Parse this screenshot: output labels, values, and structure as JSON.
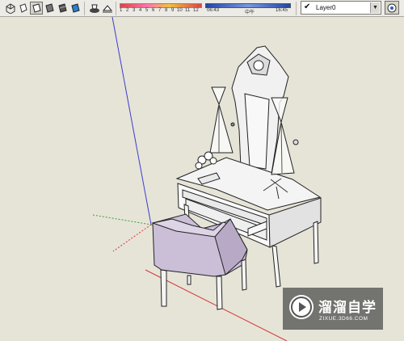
{
  "toolbar": {
    "view_buttons": [
      {
        "name": "xray-style-icon"
      },
      {
        "name": "wireframe-style-icon"
      },
      {
        "name": "hidden-line-style-icon",
        "active": true
      },
      {
        "name": "shaded-style-icon"
      },
      {
        "name": "shaded-textures-style-icon"
      },
      {
        "name": "monochrome-style-icon"
      }
    ],
    "months": [
      "1",
      "2",
      "3",
      "4",
      "5",
      "6",
      "7",
      "8",
      "9",
      "10",
      "11",
      "12"
    ],
    "time_start": "06:43",
    "time_mid": "中午",
    "time_end": "16:45"
  },
  "layer": {
    "checkmark": "✔",
    "current": "Layer0"
  },
  "watermark": {
    "brand": "溜溜自学",
    "url": "ZIXUE.3D66.COM"
  },
  "colors": {
    "viewport_bg": "#e6e4d7",
    "blue_axis": "#3c3cd0",
    "red_axis": "#d03a3a",
    "green_axis": "#3aa03a",
    "chair_fill": "#cbbfd8"
  }
}
